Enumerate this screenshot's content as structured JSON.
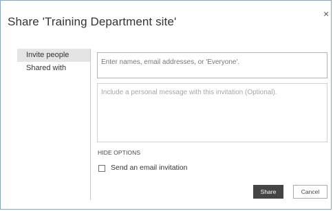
{
  "dialog": {
    "title": "Share 'Training Department site'",
    "close_glyph": "×"
  },
  "nav": {
    "items": [
      {
        "label": "Invite people",
        "active": true
      },
      {
        "label": "Shared with",
        "active": false
      }
    ]
  },
  "invite": {
    "placeholder": "Enter names, email addresses, or 'Everyone'.",
    "value": ""
  },
  "message": {
    "placeholder": "Include a personal message with this invitation (Optional).",
    "value": ""
  },
  "options": {
    "hide_label": "HIDE OPTIONS",
    "email_invitation_label": "Send an email invitation",
    "email_invitation_checked": false
  },
  "buttons": {
    "share_label": "Share",
    "cancel_label": "Cancel"
  },
  "colors": {
    "frame_border": "#7fa6cf",
    "primary_button": "#444444",
    "active_nav": "#e4e4e4"
  }
}
